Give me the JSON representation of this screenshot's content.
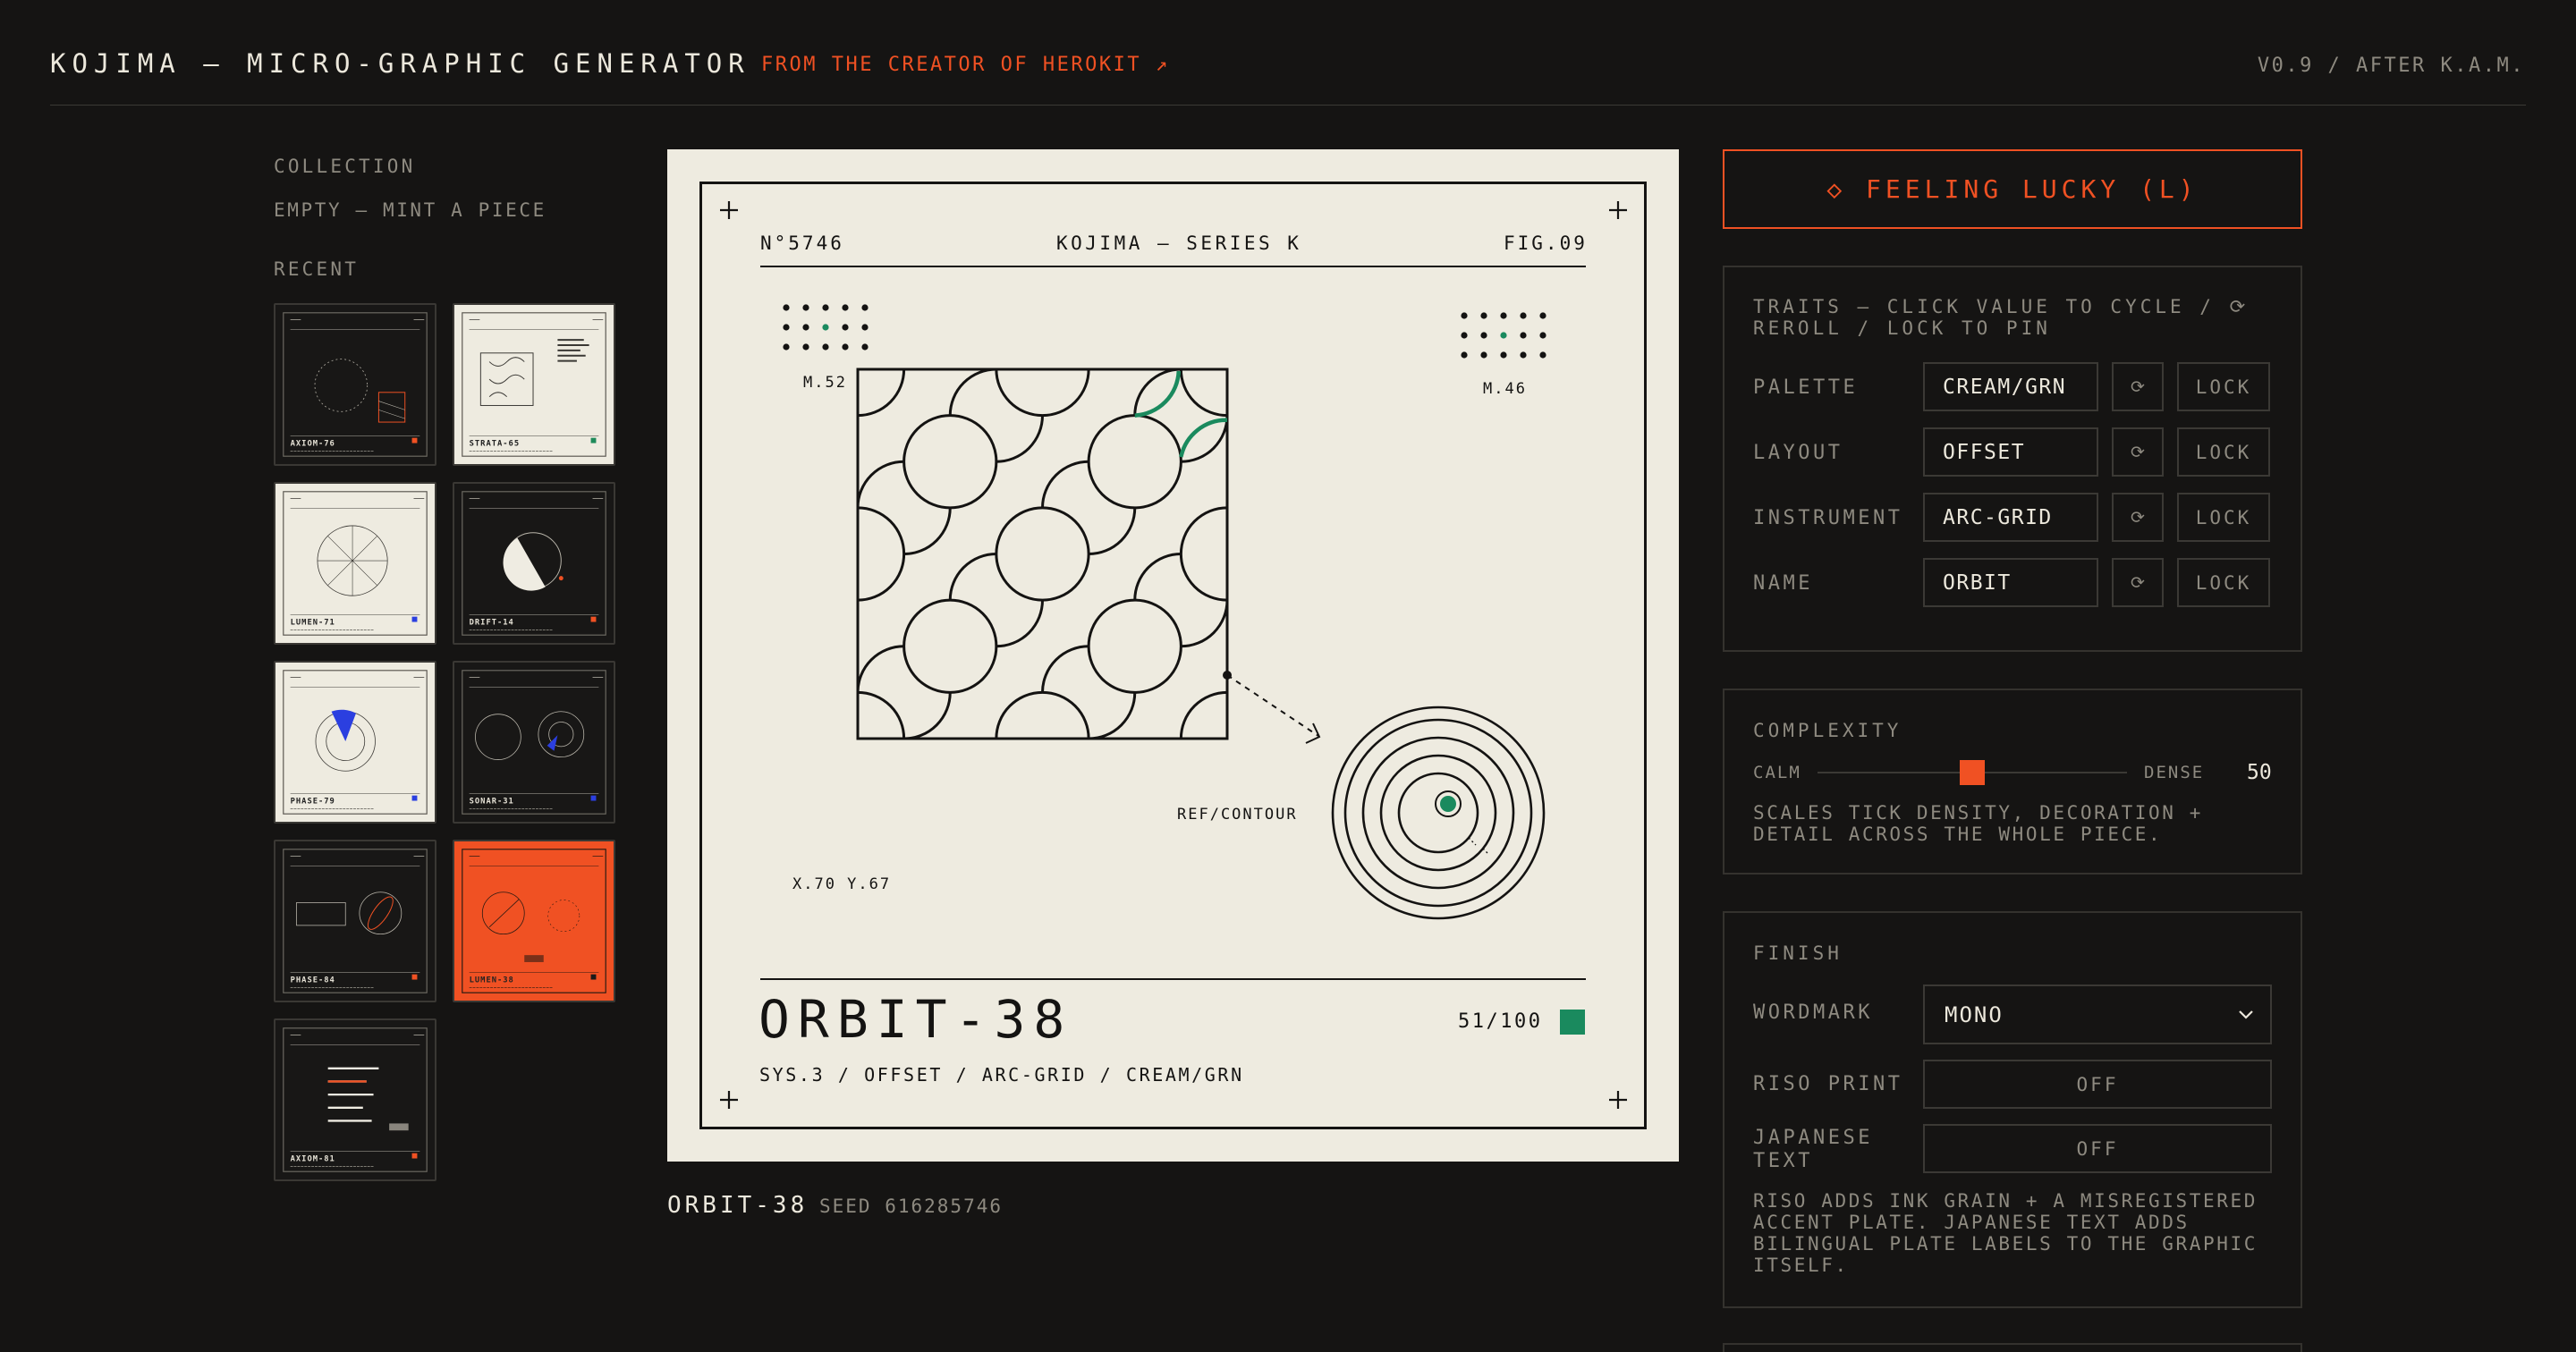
{
  "header": {
    "title": "KOJIMA — MICRO-GRAPHIC GENERATOR",
    "creator_link": "FROM THE CREATOR OF HEROKIT ↗",
    "version": "V0.9 / AFTER K.A.M."
  },
  "sidebar": {
    "collection_heading": "COLLECTION",
    "collection_empty": "EMPTY — MINT A PIECE",
    "recent_heading": "RECENT",
    "recent": [
      {
        "name": "AXIOM-76",
        "theme": "dark",
        "motif": "cluster",
        "accent": "#f05123"
      },
      {
        "name": "STRATA-65",
        "theme": "light",
        "motif": "maze",
        "accent": "#1e8a5a"
      },
      {
        "name": "LUMEN-71",
        "theme": "light",
        "motif": "dial",
        "accent": "#2b3fe0"
      },
      {
        "name": "DRIFT-14",
        "theme": "dark",
        "motif": "halfmoon",
        "accent": "#f05123"
      },
      {
        "name": "PHASE-79",
        "theme": "light",
        "motif": "sweep",
        "accent": "#2b3fe0"
      },
      {
        "name": "SONAR-31",
        "theme": "dark",
        "motif": "sonar",
        "accent": "#2b3fe0"
      },
      {
        "name": "PHASE-84",
        "theme": "dark",
        "motif": "ellipse",
        "accent": "#f05123"
      },
      {
        "name": "LUMEN-38",
        "theme": "orange",
        "motif": "orange",
        "accent": "#1a1a1a"
      },
      {
        "name": "AXIOM-81",
        "theme": "dark",
        "motif": "bars",
        "accent": "#f05123"
      }
    ]
  },
  "poster": {
    "number": "N°5746",
    "series": "KOJIMA — SERIES K",
    "figure": "FIG.09",
    "marker_left": "M.52",
    "marker_right": "M.46",
    "ref_label": "REF/CONTOUR",
    "coords": "X.70 Y.67",
    "title": "ORBIT-38",
    "edition": "51/100",
    "spec": "SYS.3 / OFFSET / ARC-GRID / CREAM/GRN",
    "accent": "#1a8a5e",
    "ink": "#141312",
    "paper": "#eeebe0"
  },
  "caption": {
    "title": "ORBIT-38",
    "seed": "SEED 616285746"
  },
  "controls": {
    "lucky_button": "◇ FEELING LUCKY (L)",
    "traits_heading": "TRAITS — CLICK VALUE TO CYCLE / ⟳ REROLL / LOCK TO PIN",
    "reroll_icon_glyph": "⟳",
    "lock_label": "LOCK",
    "traits": [
      {
        "label": "PALETTE",
        "value": "CREAM/GRN"
      },
      {
        "label": "LAYOUT",
        "value": "OFFSET"
      },
      {
        "label": "INSTRUMENT",
        "value": "ARC-GRID"
      },
      {
        "label": "NAME",
        "value": "ORBIT"
      }
    ],
    "complexity": {
      "heading": "COMPLEXITY",
      "min_label": "CALM",
      "max_label": "DENSE",
      "value": 50,
      "value_text": "50",
      "note": "SCALES TICK DENSITY, DECORATION + DETAIL ACROSS THE WHOLE PIECE."
    },
    "finish": {
      "heading": "FINISH",
      "wordmark_label": "WORDMARK",
      "wordmark_value": "MONO",
      "riso_label": "RISO PRINT",
      "riso_value": "OFF",
      "japanese_label_line1": "JAPANESE",
      "japanese_label_line2": "TEXT",
      "japanese_value": "OFF",
      "note": "RISO ADDS INK GRAIN + A MISREGISTERED ACCENT PLATE. JAPANESE TEXT ADDS BILINGUAL PLATE LABELS TO THE GRAPHIC ITSELF."
    }
  },
  "colors": {
    "background": "#151413",
    "accent_orange": "#f05123",
    "text_primary": "#ece8dc",
    "text_muted": "#8e8a80",
    "border": "#3b3935"
  }
}
